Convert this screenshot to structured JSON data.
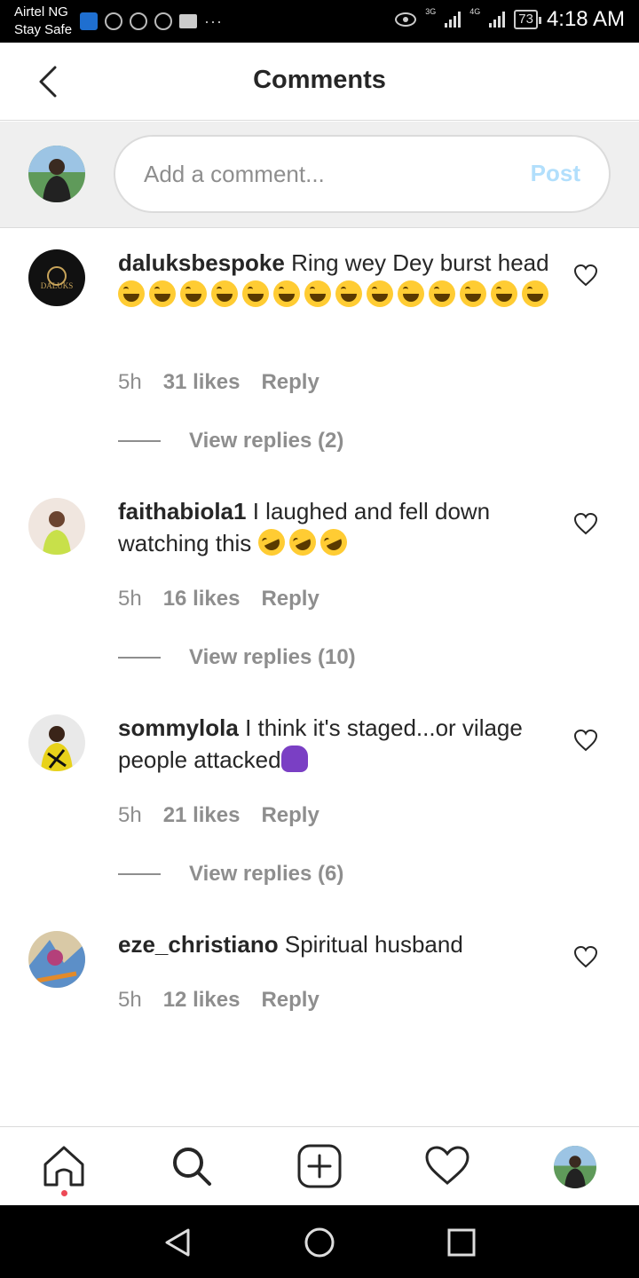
{
  "status_bar": {
    "carrier": "Airtel NG",
    "carrier_sub": "Stay Safe",
    "network_1": "3G",
    "network_2": "4G",
    "battery": "73",
    "time": "4:18 AM"
  },
  "header": {
    "title": "Comments",
    "back_icon": "back-chevron-icon"
  },
  "composer": {
    "placeholder": "Add a comment...",
    "post_label": "Post",
    "post_color": "#b2dffc"
  },
  "comments": [
    {
      "username": "daluksbespoke",
      "text": "Ring wey Dey burst head",
      "emoji": "face-with-tears-of-joy x14",
      "time": "5h",
      "likes": "31 likes",
      "reply": "Reply",
      "view_replies": "View replies (2)",
      "avatar_text": "DALUKS"
    },
    {
      "username": "faithabiola1",
      "text": "I laughed and fell down watching this",
      "emoji": "rolling-on-floor-laughing x3",
      "time": "5h",
      "likes": "16 likes",
      "reply": "Reply",
      "view_replies": "View replies (10)"
    },
    {
      "username": "sommylola",
      "text": "I think it's staged...or vilage people attacked",
      "emoji": "person-shrugging",
      "time": "5h",
      "likes": "21 likes",
      "reply": "Reply",
      "view_replies": "View replies (6)"
    },
    {
      "username": "eze_christiano",
      "text": "Spiritual husband",
      "time": "5h",
      "likes": "12 likes",
      "reply": "Reply"
    }
  ],
  "tab_bar": {
    "items": [
      "home-icon",
      "search-icon",
      "add-post-icon",
      "heart-icon",
      "profile-avatar"
    ],
    "notification_dot_color": "#ed4956"
  },
  "nav_bar": {
    "items": [
      "back-triangle-icon",
      "home-circle-icon",
      "recents-square-icon"
    ]
  }
}
